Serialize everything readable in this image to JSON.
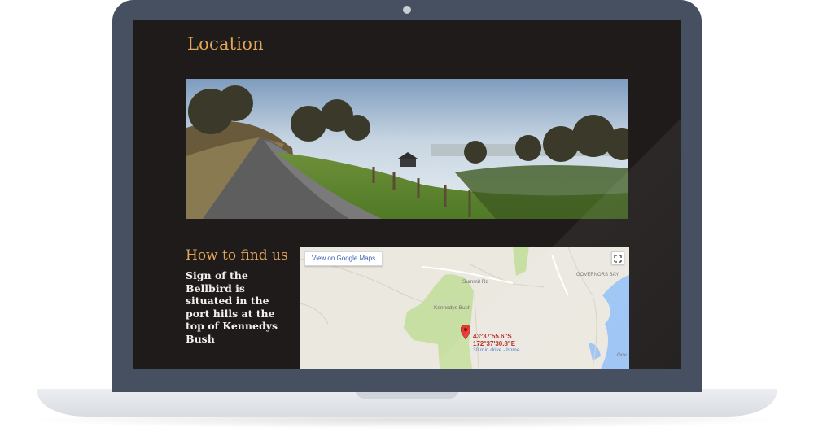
{
  "page": {
    "title": "Location"
  },
  "hero_image": {
    "alt": "Roadside panorama of the port hills"
  },
  "find_us": {
    "heading": "How to find us",
    "body": "Sign of the Bellbird is situated in the port hills at the top of Kennedys Bush"
  },
  "map": {
    "view_button_label": "View on Google Maps",
    "expand_icon": "expand-icon",
    "pin_icon": "map-pin-icon",
    "labels": {
      "road": "Summit Rd",
      "park": "Kennedys Bush",
      "suburb": "GOVERNORS BAY",
      "water": "Gov"
    },
    "coordinates_line1": "43°37'55.6\"S",
    "coordinates_line2": "172°37'30.8\"E",
    "drive_link": "30 min drive - home"
  },
  "colors": {
    "heading": "#e4a558",
    "screen_background": "#1f1b1b",
    "laptop_bezel": "#465061",
    "pin_red": "#e53935",
    "park_green": "#c8dfa3",
    "water_blue": "#9cc4f5"
  }
}
